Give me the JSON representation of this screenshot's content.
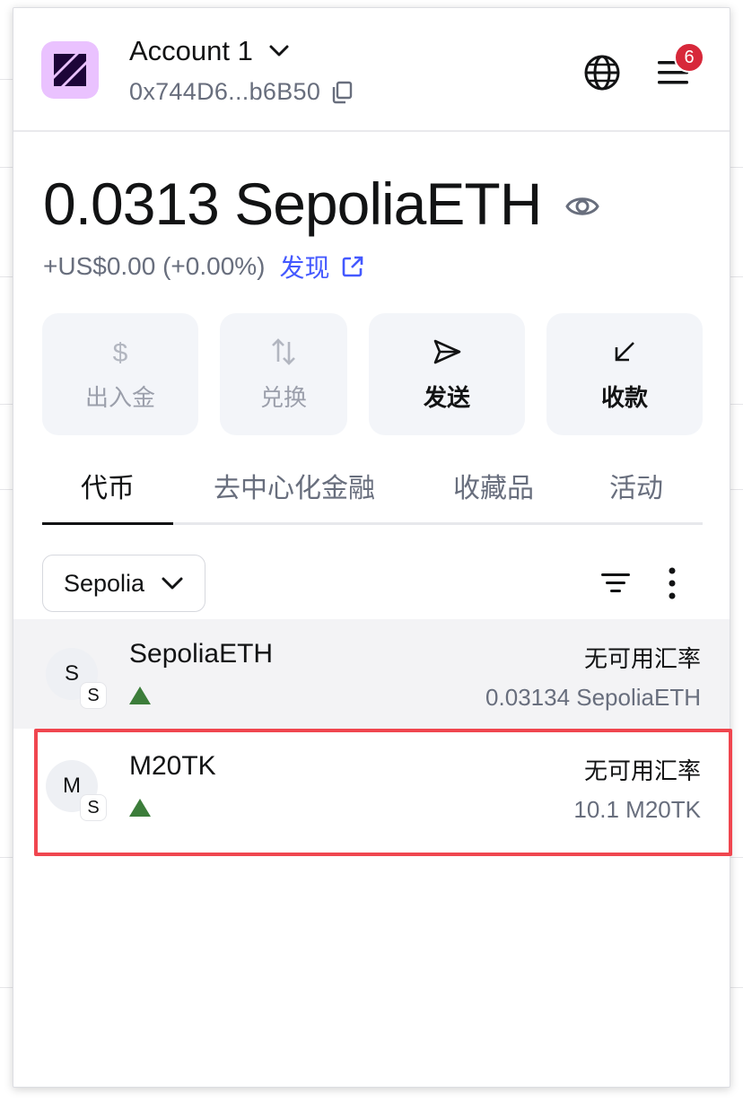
{
  "header": {
    "account_name": "Account 1",
    "address": "0x744D6...b6B50",
    "notification_count": "6"
  },
  "balance": {
    "amount": "0.0313 SepoliaETH",
    "change": "+US$0.00 (+0.00%)",
    "discover_label": "发现"
  },
  "actions": [
    {
      "label": "出入金",
      "icon": "dollar-icon",
      "enabled": false
    },
    {
      "label": "兑换",
      "icon": "swap-icon",
      "enabled": false
    },
    {
      "label": "发送",
      "icon": "send-icon",
      "enabled": true
    },
    {
      "label": "收款",
      "icon": "receive-icon",
      "enabled": true
    }
  ],
  "tabs": [
    {
      "label": "代币",
      "active": true
    },
    {
      "label": "去中心化金融",
      "active": false
    },
    {
      "label": "收藏品",
      "active": false
    },
    {
      "label": "活动",
      "active": false
    }
  ],
  "network_filter": {
    "selected": "Sepolia"
  },
  "tokens": [
    {
      "avatar_letter": "S",
      "network_letter": "S",
      "name": "SepoliaETH",
      "rate": "无可用汇率",
      "amount": "0.03134 SepoliaETH"
    },
    {
      "avatar_letter": "M",
      "network_letter": "S",
      "name": "M20TK",
      "rate": "无可用汇率",
      "amount": "10.1 M20TK"
    }
  ],
  "colors": {
    "accent": "#4459ff",
    "badge": "#d7283a",
    "trend_up": "#3c7d3a",
    "highlight_border": "#f0464f",
    "avatar_bg": "#eac2ff"
  }
}
